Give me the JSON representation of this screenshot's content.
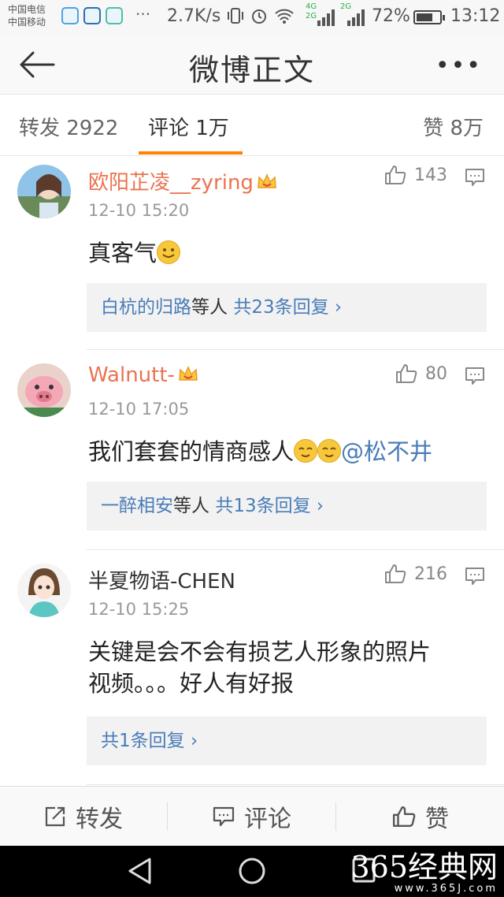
{
  "status_bar": {
    "carrier_1": "中国电信",
    "carrier_2": "中国移动",
    "overflow": "···",
    "speed": "2.7K/s",
    "net_1_top": "4G",
    "net_1_bottom": "2G",
    "net_2": "2G",
    "battery": "72%",
    "battery_level": 0.72,
    "time": "13:12"
  },
  "nav": {
    "title": "微博正文",
    "more": "•••",
    "back_icon": "arrow-left-icon"
  },
  "tabs": {
    "repost": "转发 2922",
    "comments": "评论 1万",
    "likes": "赞 8万",
    "active": "comments",
    "accent_color": "#ff8200"
  },
  "comments": [
    {
      "username": "欧阳芷凌__zyring",
      "vip": true,
      "time": "12-10 15:20",
      "likes": "143",
      "text": "真客气",
      "emoji": [
        "smile"
      ],
      "mention": "",
      "replies": {
        "name": "白杭的归路",
        "suffix": "等人",
        "count": "共23条回复 ›"
      }
    },
    {
      "username": "Walnutt-",
      "vip": true,
      "time": "12-10 17:05",
      "likes": "80",
      "text": "我们套套的情商感人",
      "emoji": [
        "relieved",
        "relieved"
      ],
      "mention": "@松不井",
      "replies": {
        "name": "一醉相安",
        "suffix": "等人",
        "count": "共13条回复 ›"
      }
    },
    {
      "username": "半夏物语-CHEN",
      "vip": false,
      "time": "12-10 15:25",
      "likes": "216",
      "text_line1": "关键是会不会有损艺人形象的照片",
      "text_line2": "视频。。。好人有好报",
      "replies": {
        "name": "",
        "suffix": "",
        "count": "共1条回复 ›"
      }
    }
  ],
  "actions": {
    "repost": "转发",
    "comment": "评论",
    "like": "赞"
  },
  "watermark": {
    "big": "365经典网",
    "small": "www.365J.com"
  },
  "colors": {
    "vip_name": "#eb7350",
    "link": "#4a7cb8"
  }
}
